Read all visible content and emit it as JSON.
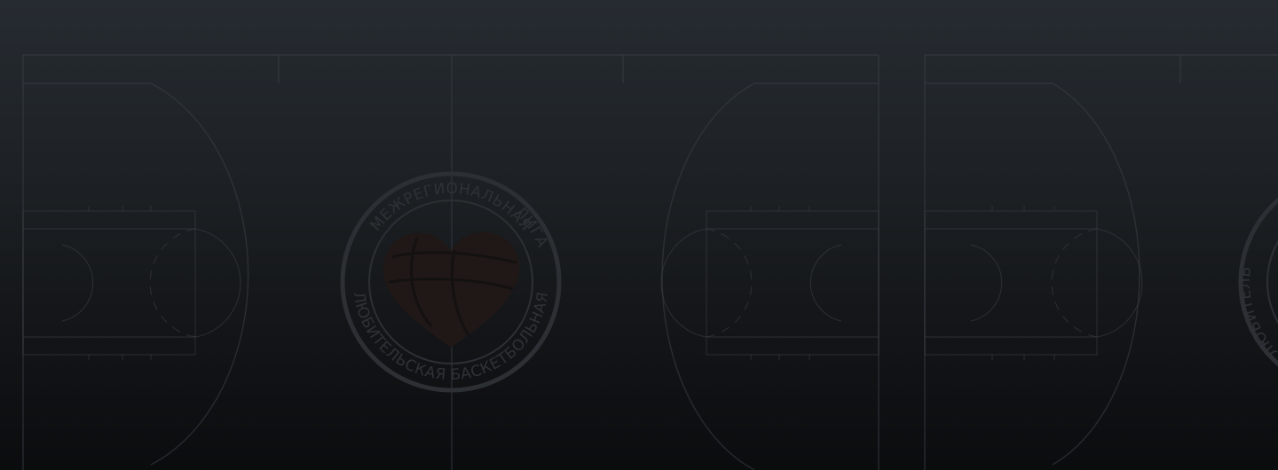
{
  "background": {
    "gradient_top": "#262b31",
    "gradient_bottom": "#0b0c0e",
    "court_line_color": "#3b4046"
  },
  "emblem": {
    "top_text": "МЕЖРЕГИОНАЛЬНАЯ",
    "right_text": "ЛИГА",
    "bottom_text": "ЛЮБИТЕЛЬСКАЯ БАСКЕТБОЛЬНАЯ",
    "center_icon": "basketball-heart-icon"
  },
  "emblem_partial": {
    "left_text": "ЛЮБИТЕЛЬ"
  }
}
